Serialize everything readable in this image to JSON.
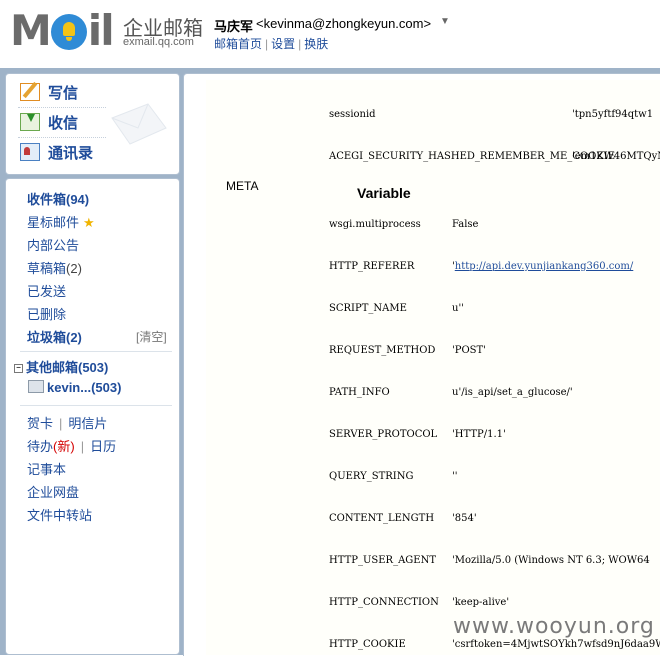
{
  "header": {
    "logo_text": "MOil",
    "logo_cn": "企业邮箱",
    "logo_url": "exmail.qq.com",
    "user_name": "马庆军",
    "user_email": "<kevinma@zhongkeyun.com>",
    "user_dropdown_icon": "▼",
    "links": [
      "邮箱首页",
      "设置",
      "换肤"
    ]
  },
  "quick_actions": [
    {
      "label": "写信",
      "icon": "write-icon"
    },
    {
      "label": "收信",
      "icon": "inbox-download-icon"
    },
    {
      "label": "通讯录",
      "icon": "address-book-icon"
    }
  ],
  "folders": {
    "inbox": "收件箱(94)",
    "starred": "星标邮件",
    "bulletin": "内部公告",
    "drafts_label": "草稿箱",
    "drafts_count": "(2)",
    "sent": "已发送",
    "deleted": "已删除",
    "spam": "垃圾箱(2)",
    "spam_clear": "[清空]",
    "other_mailboxes": "其他邮箱(503)",
    "account": "kevin...(503)"
  },
  "apps": {
    "card": "贺卡",
    "postcard": "明信片",
    "todo": "待办",
    "todo_new": "(新)",
    "calendar": "日历",
    "notepad": "记事本",
    "netdisk": "企业网盘",
    "transfer": "文件中转站"
  },
  "content": {
    "meta_label": "META",
    "variable_heading": "Variable",
    "session_rows": [
      {
        "key": "sessionid",
        "value": "'tpn5yftf94qtw1"
      },
      {
        "key": "ACEGI_SECURITY_HASHED_REMEMBER_ME_COOKIE",
        "value": "'em1ZW46MTQyNz"
      }
    ],
    "meta_rows": [
      {
        "key": "wsgi.multiprocess",
        "value": "False"
      },
      {
        "key": "HTTP_REFERER",
        "value_prefix": "'",
        "value_link": "http://api.dev.yunjiankang360.com/"
      },
      {
        "key": "SCRIPT_NAME",
        "value": "u''"
      },
      {
        "key": "REQUEST_METHOD",
        "value": "'POST'"
      },
      {
        "key": "PATH_INFO",
        "value": "u'/is_api/set_a_glucose/'"
      },
      {
        "key": "SERVER_PROTOCOL",
        "value": "'HTTP/1.1'"
      },
      {
        "key": "QUERY_STRING",
        "value": "''"
      },
      {
        "key": "CONTENT_LENGTH",
        "value": "'854'"
      },
      {
        "key": "HTTP_USER_AGENT",
        "value": "'Mozilla/5.0 (Windows NT 6.3; WOW64"
      },
      {
        "key": "HTTP_CONNECTION",
        "value": "'keep-alive'"
      },
      {
        "key": "HTTP_COOKIE",
        "value": "'csrftoken=4MjwtSOYkh7wfsd9nJ6daa9W"
      }
    ]
  },
  "watermark": "www.wooyun.org"
}
